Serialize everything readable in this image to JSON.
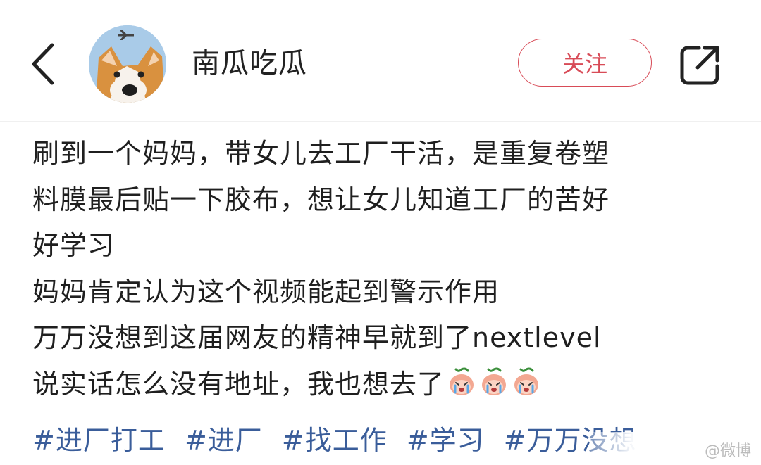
{
  "header": {
    "back_icon": "chevron-left-icon",
    "username": "南瓜吃瓜",
    "follow_label": "关注",
    "share_icon": "share-icon",
    "accent_color": "#d84b57"
  },
  "post": {
    "lines": [
      "刷到一个妈妈，带女儿去工厂干活，是重复卷塑",
      "料膜最后贴一下胶布，想让女儿知道工厂的苦好",
      "好学习",
      "妈妈肯定认为这个视频能起到警示作用",
      "万万没想到这届网友的精神早就到了nextlevel",
      "说实话怎么没有地址，我也想去了"
    ],
    "emoji_icon": "crying-peach-emoji",
    "tags": [
      "#进厂打工",
      "#进厂",
      "#找工作",
      "#学习",
      "#万万没想"
    ],
    "tag_color": "#3a5d9a"
  },
  "watermark": "@微博"
}
